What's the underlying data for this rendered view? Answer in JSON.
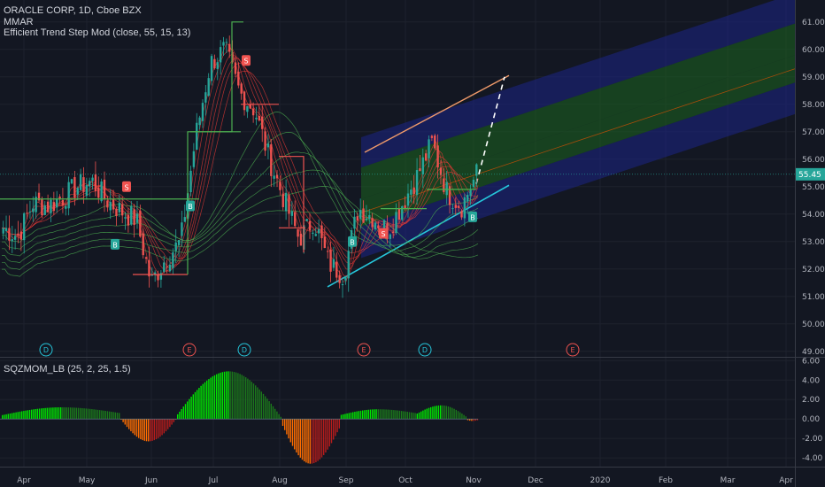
{
  "legend": {
    "title": "ORACLE CORP, 1D, Cboe BZX",
    "line2": "MMAR",
    "line3": "Efficient Trend Step Mod (close, 55, 15, 13)",
    "osc": "SQZMOM_LB (25, 2, 25, 1.5)"
  },
  "colors": {
    "bg": "#131722",
    "up": "#26a69a",
    "down": "#ef5350",
    "ma_green": "#4caf50",
    "ma_red": "#e53935",
    "channel_blue": "#1a237e",
    "channel_green": "#1b5e20",
    "mom_green_bright": "#00e600",
    "mom_green_dark": "#1b7a1b",
    "mom_red_bright": "#ff6d00",
    "mom_red_dark": "#b71c1c"
  },
  "chart_data": [
    {
      "type": "line",
      "title": "ORACLE CORP, 1D, Cboe BZX",
      "ylabel": "",
      "ylim": [
        48.8,
        61.8
      ],
      "yticks": [
        "61.00",
        "60.00",
        "59.00",
        "58.00",
        "57.00",
        "56.00",
        "55.00",
        "54.00",
        "53.00",
        "52.00",
        "51.00",
        "50.00",
        "49.00"
      ],
      "ytick_values": [
        61,
        60,
        59,
        58,
        57,
        56,
        55,
        54,
        53,
        52,
        51,
        50,
        49
      ],
      "last_price": "55.45",
      "xticks": [
        "Apr",
        "May",
        "Jun",
        "Jul",
        "Aug",
        "Sep",
        "Oct",
        "Nov",
        "Dec",
        "2020",
        "Feb",
        "Mar",
        "Apr"
      ],
      "series": [
        {
          "name": "close",
          "x": [
            "Mar 22",
            "Mar 29",
            "Apr 5",
            "Apr 12",
            "Apr 19",
            "Apr 26",
            "May 3",
            "May 10",
            "May 17",
            "May 24",
            "May 31",
            "Jun 7",
            "Jun 14",
            "Jun 21",
            "Jun 28",
            "Jul 5",
            "Jul 12",
            "Jul 19",
            "Jul 26",
            "Aug 2",
            "Aug 9",
            "Aug 16",
            "Aug 23",
            "Aug 30",
            "Sep 6",
            "Sep 13",
            "Sep 20",
            "Sep 27",
            "Oct 4",
            "Oct 11",
            "Oct 18",
            "Oct 25",
            "Nov 1"
          ],
          "values": [
            53.5,
            53.2,
            54.4,
            54.3,
            54.6,
            55.0,
            55.2,
            54.5,
            54.1,
            53.8,
            51.5,
            52.4,
            53.0,
            56.8,
            59.5,
            60.0,
            58.4,
            57.8,
            56.0,
            54.5,
            53.1,
            53.8,
            52.2,
            51.8,
            54.2,
            53.9,
            53.4,
            54.4,
            55.4,
            56.6,
            54.8,
            54.3,
            55.45
          ]
        }
      ],
      "event_markers": [
        "D",
        "E",
        "D",
        "E",
        "D",
        "E"
      ],
      "annotations": [
        "B",
        "S",
        "B",
        "S",
        "B",
        "S",
        "B"
      ]
    },
    {
      "type": "bar",
      "title": "SQZMOM_LB (25, 2, 25, 1.5)",
      "ylim": [
        -4.9,
        6.3
      ],
      "yticks": [
        "6.00",
        "4.00",
        "2.00",
        "0.00",
        "-2.00",
        "-4.00"
      ],
      "ytick_values": [
        6,
        4,
        2,
        0,
        -2,
        -4
      ],
      "series": [
        {
          "name": "momentum",
          "segments": [
            {
              "from": 0.0,
              "to": 0.7,
              "start": 0.4,
              "peak": 1.2,
              "end": 0.6
            },
            {
              "from": 0.7,
              "to": 1.03,
              "start": 0.0,
              "peak": -2.3,
              "end": 0.0
            },
            {
              "from": 1.03,
              "to": 1.65,
              "start": 0.3,
              "peak": 4.9,
              "end": 0.2
            },
            {
              "from": 1.65,
              "to": 2.0,
              "start": -0.3,
              "peak": -4.6,
              "end": -0.8
            },
            {
              "from": 2.0,
              "to": 2.45,
              "start": 0.4,
              "peak": 1.0,
              "end": 0.6
            },
            {
              "from": 2.45,
              "to": 2.75,
              "start": 0.5,
              "peak": 1.4,
              "end": 0.2
            },
            {
              "from": 2.75,
              "to": 2.82,
              "start": -0.1,
              "peak": -0.2,
              "end": -0.1
            }
          ]
        }
      ]
    }
  ]
}
